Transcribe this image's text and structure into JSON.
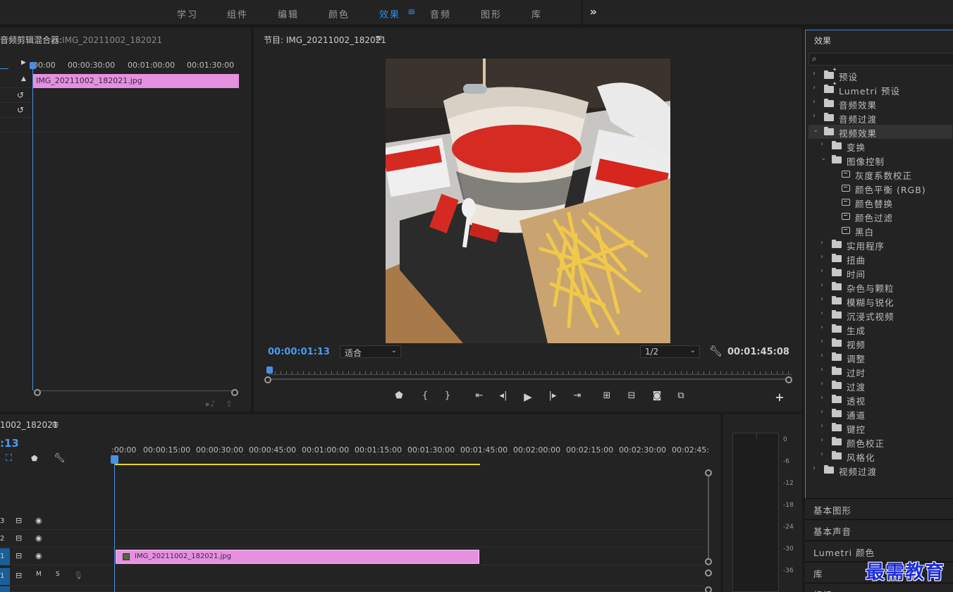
{
  "workspaces": {
    "tabs": [
      "学习",
      "组件",
      "编辑",
      "颜色",
      "效果",
      "音频",
      "图形",
      "库"
    ],
    "active": "效果",
    "overflow": "»"
  },
  "mixer": {
    "title": "音频剪辑混合器:",
    "clip_name": "IMG_20211002_182021",
    "ruler": [
      "00:00",
      "00:00:30:00",
      "00:01:00:00",
      "00:01:30:00"
    ],
    "clip_label": "IMG_20211002_182021.jpg"
  },
  "program": {
    "title": "节目: IMG_20211002_182021",
    "timecode_current": "00:00:01:13",
    "zoom": "适合",
    "resolution": "1/2",
    "timecode_total": "00:01:45:08"
  },
  "timeline": {
    "sequence_name": "1002_182021",
    "timecode": ":13",
    "ruler": [
      ":00:00",
      "00:00:15:00",
      "00:00:30:00",
      "00:00:45:00",
      "00:01:00:00",
      "00:01:15:00",
      "00:01:30:00",
      "00:01:45:00",
      "00:02:00:00",
      "00:02:15:00",
      "00:02:30:00",
      "00:02:45:"
    ],
    "tracks": [
      {
        "id": "3",
        "type": "video"
      },
      {
        "id": "2",
        "type": "video"
      },
      {
        "id": "1",
        "type": "video"
      },
      {
        "id": "1",
        "type": "audio",
        "m": "M",
        "s": "S"
      }
    ],
    "clip_label": "IMG_20211002_182021.jpg"
  },
  "meter": {
    "scale": [
      "0",
      "-6",
      "-12",
      "-18",
      "-24",
      "-30",
      "-36"
    ]
  },
  "effects": {
    "title": "效果",
    "tree": [
      {
        "label": "预设",
        "level": 0,
        "kind": "folder-star",
        "open": false
      },
      {
        "label": "Lumetri 预设",
        "level": 0,
        "kind": "folder-star",
        "open": false
      },
      {
        "label": "音频效果",
        "level": 0,
        "kind": "folder",
        "open": false
      },
      {
        "label": "音频过渡",
        "level": 0,
        "kind": "folder",
        "open": false
      },
      {
        "label": "视频效果",
        "level": 0,
        "kind": "folder",
        "open": true,
        "selected": true
      },
      {
        "label": "变换",
        "level": 1,
        "kind": "folder",
        "open": false
      },
      {
        "label": "图像控制",
        "level": 1,
        "kind": "folder",
        "open": true
      },
      {
        "label": "灰度系数校正",
        "level": 2,
        "kind": "effect"
      },
      {
        "label": "颜色平衡 (RGB)",
        "level": 2,
        "kind": "effect"
      },
      {
        "label": "颜色替换",
        "level": 2,
        "kind": "effect"
      },
      {
        "label": "颜色过滤",
        "level": 2,
        "kind": "effect"
      },
      {
        "label": "黑白",
        "level": 2,
        "kind": "effect"
      },
      {
        "label": "实用程序",
        "level": 1,
        "kind": "folder",
        "open": false
      },
      {
        "label": "扭曲",
        "level": 1,
        "kind": "folder",
        "open": false
      },
      {
        "label": "时间",
        "level": 1,
        "kind": "folder",
        "open": false
      },
      {
        "label": "杂色与颗粒",
        "level": 1,
        "kind": "folder",
        "open": false
      },
      {
        "label": "模糊与锐化",
        "level": 1,
        "kind": "folder",
        "open": false
      },
      {
        "label": "沉浸式视频",
        "level": 1,
        "kind": "folder",
        "open": false
      },
      {
        "label": "生成",
        "level": 1,
        "kind": "folder",
        "open": false
      },
      {
        "label": "视频",
        "level": 1,
        "kind": "folder",
        "open": false
      },
      {
        "label": "调整",
        "level": 1,
        "kind": "folder",
        "open": false
      },
      {
        "label": "过时",
        "level": 1,
        "kind": "folder",
        "open": false
      },
      {
        "label": "过渡",
        "level": 1,
        "kind": "folder",
        "open": false
      },
      {
        "label": "透视",
        "level": 1,
        "kind": "folder",
        "open": false
      },
      {
        "label": "通道",
        "level": 1,
        "kind": "folder",
        "open": false
      },
      {
        "label": "键控",
        "level": 1,
        "kind": "folder",
        "open": false
      },
      {
        "label": "颜色校正",
        "level": 1,
        "kind": "folder",
        "open": false
      },
      {
        "label": "风格化",
        "level": 1,
        "kind": "folder",
        "open": false
      },
      {
        "label": "视频过渡",
        "level": 0,
        "kind": "folder",
        "open": false
      }
    ]
  },
  "side_panels": [
    "基本图形",
    "基本声音",
    "Lumetri 颜色",
    "库",
    "标记"
  ],
  "watermark": "最需教育",
  "colors": {
    "accent": "#2d8ceb",
    "clip": "#e690e0",
    "work_area": "#e8d21b",
    "watermark": "#1f2ed8"
  }
}
